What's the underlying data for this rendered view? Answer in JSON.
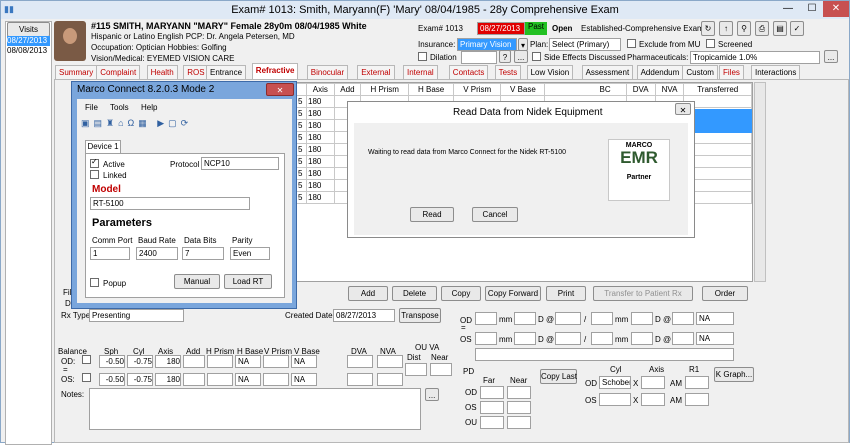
{
  "window": {
    "title": "Exam# 1013:  Smith, Maryann(F) 'Mary' 08/04/1985 - 28y Comprehensive Exam",
    "min": "—",
    "max": "☐",
    "close": "✕"
  },
  "visits": {
    "label": "Visits",
    "dates": [
      "08/27/2013",
      "08/08/2013"
    ]
  },
  "patient": {
    "line1": "#115 SMITH, MARYANN  \"MARY\" Female 28y0m 08/04/1985  White",
    "line2": "Hispanic or Latino English PCP: Dr. Angela Petersen, MD",
    "line3": "Occupation: Optician Hobbies: Golfing",
    "line4": "Vision/Medical:  EYEMED VISION CARE"
  },
  "exam": {
    "label": "Exam# 1013",
    "date": "08/27/2013",
    "past": "Past",
    "open": "Open",
    "type": "Established-Comprehensive Exam"
  },
  "insurance": {
    "label": "Insurance:",
    "value": "Primary Vision",
    "plan_label": "Plan:",
    "plan_value": "Select  (Primary)",
    "exclude": "Exclude from MU",
    "screened": "Screened",
    "dilation": "Dilation",
    "side_effects": "Side Effects Discussed",
    "pharm_label": "Pharmaceuticals:",
    "pharm_value": "Tropicamide 1.0%",
    "dots": "..."
  },
  "tabs": [
    {
      "label": "Summary",
      "red": true
    },
    {
      "label": "Complaint",
      "red": true
    },
    {
      "label": "Health",
      "red": true
    },
    {
      "label": "ROS",
      "red": true
    },
    {
      "label": "Entrance",
      "red": false
    },
    {
      "label": "Refractive",
      "red": true
    },
    {
      "label": "Binocular",
      "red": true
    },
    {
      "label": "External",
      "red": true
    },
    {
      "label": "Internal",
      "red": true
    },
    {
      "label": "Contacts",
      "red": true
    },
    {
      "label": "Tests",
      "red": true
    },
    {
      "label": "Low Vision",
      "red": false
    },
    {
      "label": "Assessment",
      "red": false
    },
    {
      "label": "Addendum",
      "red": false
    },
    {
      "label": "Custom",
      "red": false
    },
    {
      "label": "Files",
      "red": true
    },
    {
      "label": "Interactions",
      "red": false
    }
  ],
  "grid": {
    "headers": [
      "Axis",
      "Add",
      "H Prism",
      "H Base",
      "V Prism",
      "V Base",
      "BC",
      "DVA",
      "NVA",
      "Transferred"
    ],
    "rows": [
      {
        "c1": "5",
        "axis": "180"
      },
      {
        "c1": "5",
        "axis": "180"
      },
      {
        "c1": "5",
        "axis": "180"
      },
      {
        "c1": "5",
        "axis": "180"
      },
      {
        "c1": "5",
        "axis": "180"
      },
      {
        "c1": "5",
        "axis": "180"
      },
      {
        "c1": "5",
        "axis": "180"
      },
      {
        "c1": "5",
        "axis": "180"
      },
      {
        "c1": "5",
        "axis": "180"
      }
    ]
  },
  "marco": {
    "title": "Marco Connect 8.2.0.3 Mode 2",
    "menu": [
      "File",
      "Tools",
      "Help"
    ],
    "device_tab": "Device 1",
    "active": "Active",
    "linked": "Linked",
    "protocol_label": "Protocol",
    "protocol": "NCP10",
    "model_label": "Model",
    "model": "RT-5100",
    "params_label": "Parameters",
    "comm_label": "Comm Port",
    "comm": "1",
    "baud_label": "Baud Rate",
    "baud": "2400",
    "bits_label": "Data Bits",
    "bits": "7",
    "parity_label": "Parity",
    "parity": "Even",
    "popup": "Popup",
    "manual": "Manual",
    "load": "Load RT"
  },
  "nidek": {
    "title": "Read Data from Nidek Equipment",
    "message": "Waiting to read data from Marco Connect for the Nidek RT-5100",
    "read": "Read",
    "cancel": "Cancel",
    "logo_top": "MARCO",
    "logo_mid": "EMR",
    "logo_bottom": "Partner"
  },
  "actions": [
    "Add",
    "Delete",
    "Copy",
    "Copy Forward",
    "Print",
    "Transfer to Patient Rx",
    "Order"
  ],
  "rx": {
    "type_label": "Rx Type:",
    "type": "Presenting",
    "created_label": "Created Date:",
    "created": "08/27/2013",
    "transpose": "Transpose",
    "headers": [
      "Balance",
      "Sph",
      "Cyl",
      "Axis",
      "Add",
      "H Prism",
      "H Base",
      "V Prism",
      "V Base",
      "DVA",
      "NVA",
      "OU VA"
    ],
    "dist": "Dist",
    "near": "Near",
    "od": {
      "label": "OD:",
      "sph": "-0.50",
      "cyl": "-0.75",
      "axis": "180",
      "hbase": "NA",
      "vbase": "NA"
    },
    "os": {
      "label": "OS:",
      "sph": "-0.50",
      "cyl": "-0.75",
      "axis": "180",
      "hbase": "NA",
      "vbase": "NA"
    },
    "notes": "Notes:"
  },
  "keratometry": {
    "od": "OD",
    "os": "OS",
    "mm": "mm",
    "d_at": "D @",
    "slash": "/",
    "na": "NA"
  },
  "pd": {
    "label": "PD",
    "far": "Far",
    "near": "Near",
    "od": "OD",
    "os": "OS",
    "ou": "OU",
    "copy_last": "Copy Last"
  },
  "cyl": {
    "cyl_label": "Cyl",
    "axis_label": "Axis",
    "r1_label": "R1",
    "od": "OD",
    "os": "OS",
    "od_value": "Schober",
    "x": "X",
    "am": "AM",
    "kgraph": "K Graph..."
  },
  "fi": "Fil",
  "d": "D"
}
